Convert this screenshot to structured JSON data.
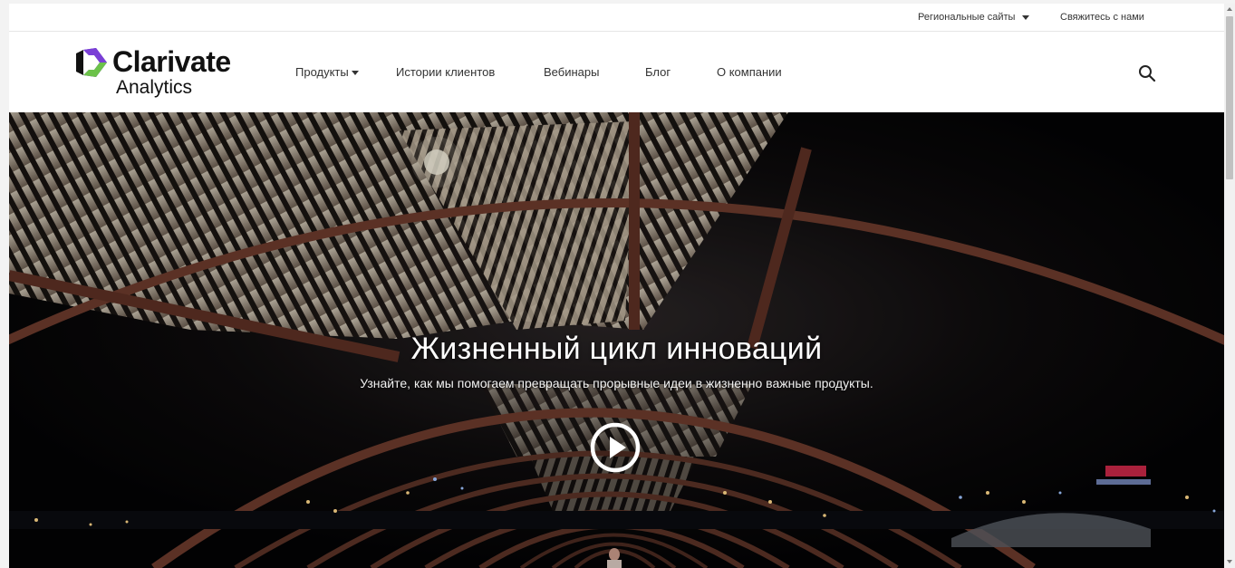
{
  "utility": {
    "regional_label": "Региональные сайты",
    "contact_label": "Свяжитесь с нами"
  },
  "header": {
    "logo_word": "Clarivate",
    "logo_sub": "Analytics",
    "nav": {
      "products": "Продукты",
      "stories": "Истории клиентов",
      "webinars": "Вебинары",
      "blog": "Блог",
      "about": "О компании"
    }
  },
  "hero": {
    "title": "Жизненный цикл инноваций",
    "subtitle": "Узнайте, как мы помогаем превращать прорывные идеи в жизненно важные продукты."
  },
  "colors": {
    "brand_green": "#6cc24a",
    "brand_purple": "#5e33bf",
    "text_dark": "#333333"
  },
  "icons": [
    "clarivate-logo-icon",
    "chevron-down-icon",
    "search-icon",
    "play-icon"
  ]
}
